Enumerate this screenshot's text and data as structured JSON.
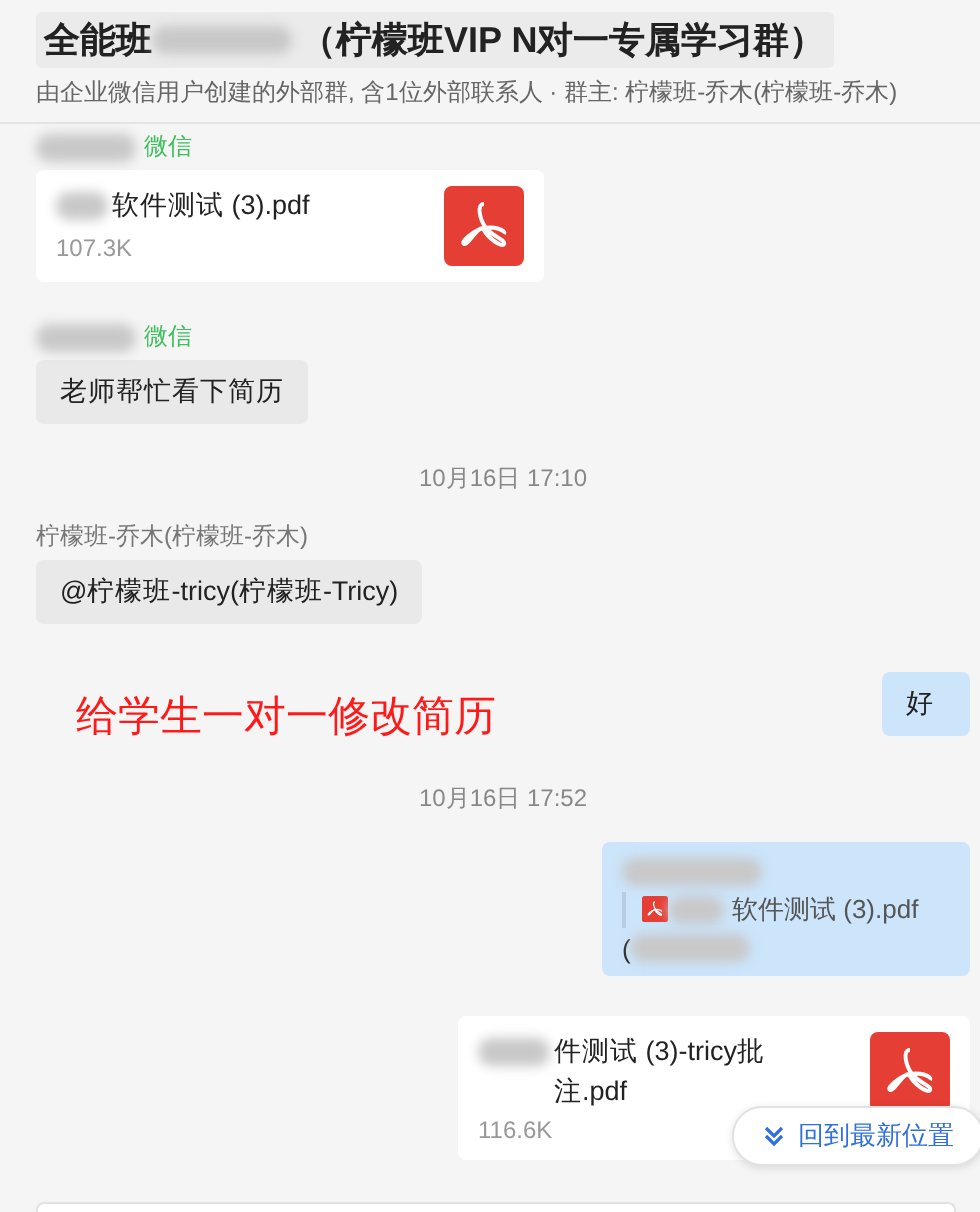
{
  "header": {
    "title_prefix": "全能班",
    "title_suffix": "（柠檬班VIP N对一专属学习群）",
    "subtitle": "由企业微信用户创建的外部群, 含1位外部联系人 · 群主: 柠檬班-乔木(柠檬班-乔木)"
  },
  "messages": [
    {
      "kind": "file",
      "outgoing": false,
      "sender_tag": "微信",
      "file_name": "软件测试 (3).pdf",
      "size": "107.3K"
    },
    {
      "kind": "text",
      "outgoing": false,
      "sender_tag": "微信",
      "text": "老师帮忙看下简历"
    },
    {
      "kind": "time",
      "text": "10月16日 17:10"
    },
    {
      "kind": "text",
      "outgoing": false,
      "sender": "柠檬班-乔木(柠檬班-乔木)",
      "text": "@柠檬班-tricy(柠檬班-Tricy)"
    },
    {
      "kind": "text",
      "outgoing": true,
      "text": "好",
      "note": "给学生一对一修改简历"
    },
    {
      "kind": "time",
      "text": "10月16日 17:52"
    },
    {
      "kind": "quote",
      "outgoing": true,
      "quoted_file": "软件测试 (3).pdf",
      "text": "("
    },
    {
      "kind": "file",
      "outgoing": true,
      "file_name": "件测试 (3)-tricy批注.pdf",
      "size": "116.6K"
    }
  ],
  "scroll_button": {
    "label": "回到最新位置"
  }
}
